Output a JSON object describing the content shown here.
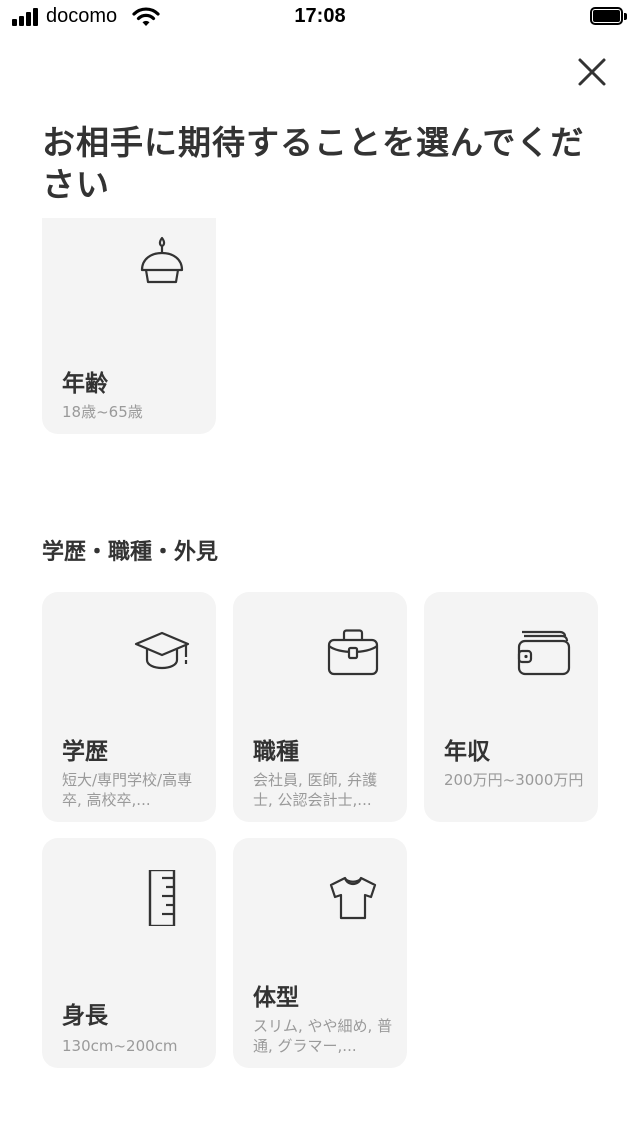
{
  "status_bar": {
    "carrier": "docomo",
    "time": "17:08"
  },
  "header": {
    "title": "お相手に期待することを選んでください"
  },
  "age_card": {
    "label": "年齢",
    "desc": "18歳~65歳",
    "icon": "cupcake-icon"
  },
  "section": {
    "title": "学歴・職種・外見"
  },
  "cards": {
    "education": {
      "label": "学歴",
      "desc": "短大/専門学校/高専卒, 高校卒,...",
      "icon": "graduation-cap-icon"
    },
    "occupation": {
      "label": "職種",
      "desc": "会社員, 医師, 弁護士, 公認会計士,...",
      "icon": "briefcase-icon"
    },
    "income": {
      "label": "年収",
      "desc": "200万円~3000万円",
      "icon": "wallet-icon"
    },
    "height": {
      "label": "身長",
      "desc": "130cm~200cm",
      "icon": "ruler-icon"
    },
    "body_type": {
      "label": "体型",
      "desc": "スリム, やや細め, 普通, グラマー,...",
      "icon": "tshirt-icon"
    }
  },
  "colors": {
    "card_bg": "#f4f4f4",
    "text_primary": "#333333",
    "text_secondary": "#9a9a9a"
  }
}
